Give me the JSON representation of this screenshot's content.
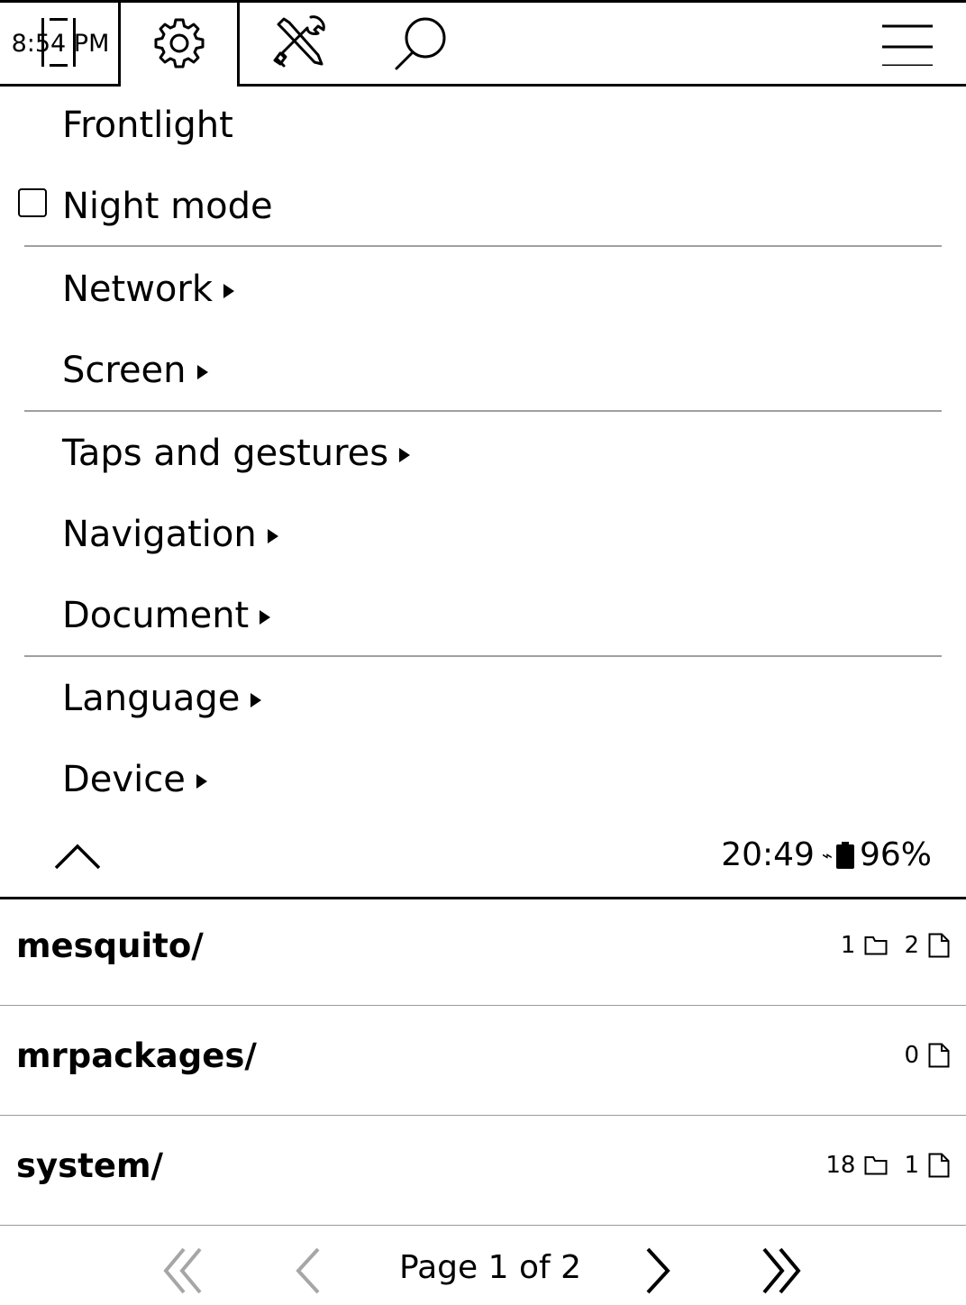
{
  "header": {
    "time": "8:54 PM",
    "tabs": [
      {
        "icon": "gear-icon",
        "label": "Settings"
      },
      {
        "icon": "tools-icon",
        "label": "Tools"
      },
      {
        "icon": "search-icon",
        "label": "Search"
      }
    ],
    "menu_icon": "hamburger-menu-icon"
  },
  "menu": {
    "items": [
      {
        "label": "Frontlight",
        "submenu": false,
        "checkbox": false
      },
      {
        "label": "Night mode",
        "submenu": false,
        "checkbox": true,
        "checked": false
      },
      {
        "label": "Network",
        "submenu": true
      },
      {
        "label": "Screen",
        "submenu": true
      },
      {
        "label": "Taps and gestures",
        "submenu": true
      },
      {
        "label": "Navigation",
        "submenu": true
      },
      {
        "label": "Document",
        "submenu": true
      },
      {
        "label": "Language",
        "submenu": true
      },
      {
        "label": "Device",
        "submenu": true
      }
    ]
  },
  "status": {
    "clock": "20:49",
    "charging_symbol": "⌁",
    "battery_icon": "battery-icon",
    "battery": "96%"
  },
  "files": [
    {
      "name": "mesquito/",
      "folders": "1",
      "files": "2"
    },
    {
      "name": "mrpackages/",
      "folders": null,
      "files": "0"
    },
    {
      "name": "system/",
      "folders": "18",
      "files": "1"
    }
  ],
  "pager": {
    "label": "Page 1 of 2"
  }
}
